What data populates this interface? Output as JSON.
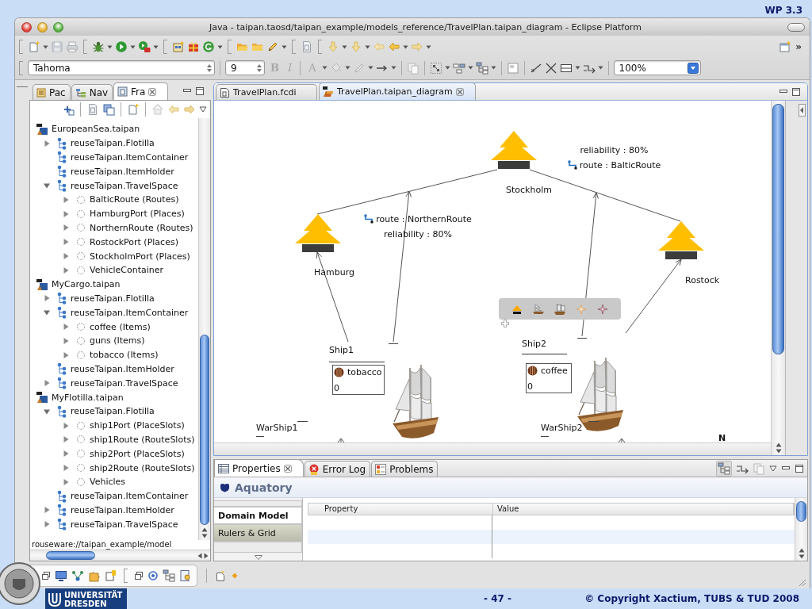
{
  "slide": {
    "section": "WP 3.3",
    "logo_text": [
      "UNIVERSITÄT",
      "DRESDEN"
    ],
    "page_number": "- 47 -",
    "copyright": "© Copyright Xactium, TUBS & TUD 2008"
  },
  "window": {
    "title": "Java - taipan.taosd/taipan_example/models_reference/TravelPlan.taipan_diagram - Eclipse Platform"
  },
  "main_toolbar": {
    "overflow": "»"
  },
  "format_toolbar": {
    "font": "Tahoma",
    "size": "9",
    "buttons": [
      {
        "label": "B",
        "kind": "bold",
        "disabled": true
      },
      {
        "label": "I",
        "kind": "italic",
        "disabled": true
      },
      {
        "label": "A",
        "kind": "font_color",
        "disabled": true
      }
    ],
    "zoom": "100%"
  },
  "navigator": {
    "tabs": [
      {
        "label": "Pac",
        "selected": false
      },
      {
        "label": "Nav",
        "selected": false
      },
      {
        "label": "Fra",
        "selected": true
      }
    ],
    "tree": [
      {
        "label": "EuropeanSea.taipan",
        "kind": "file",
        "children": [
          {
            "label": "reuseTaipan.Flotilla",
            "kind": "package",
            "expanded": false
          },
          {
            "label": "reuseTaipan.ItemContainer",
            "kind": "package"
          },
          {
            "label": "reuseTaipan.ItemHolder",
            "kind": "package"
          },
          {
            "label": "reuseTaipan.TravelSpace",
            "kind": "package",
            "expanded": true,
            "children": [
              {
                "label": "BalticRoute (Routes)",
                "kind": "element",
                "expanded": false
              },
              {
                "label": "HamburgPort (Places)",
                "kind": "element",
                "expanded": false
              },
              {
                "label": "NorthernRoute (Routes)",
                "kind": "element",
                "expanded": false
              },
              {
                "label": "RostockPort (Places)",
                "kind": "element",
                "expanded": false
              },
              {
                "label": "StockholmPort (Places)",
                "kind": "element",
                "expanded": false
              },
              {
                "label": "VehicleContainer",
                "kind": "element",
                "expanded": false
              }
            ]
          }
        ]
      },
      {
        "label": "MyCargo.taipan",
        "kind": "file",
        "children": [
          {
            "label": "reuseTaipan.Flotilla",
            "kind": "package",
            "expanded": false
          },
          {
            "label": "reuseTaipan.ItemContainer",
            "kind": "package",
            "expanded": true,
            "children": [
              {
                "label": "coffee (Items)",
                "kind": "element",
                "expanded": false
              },
              {
                "label": "guns (Items)",
                "kind": "element",
                "expanded": false
              },
              {
                "label": "tobacco (Items)",
                "kind": "element",
                "expanded": false
              }
            ]
          },
          {
            "label": "reuseTaipan.ItemHolder",
            "kind": "package"
          },
          {
            "label": "reuseTaipan.TravelSpace",
            "kind": "package",
            "expanded": false
          }
        ]
      },
      {
        "label": "MyFlotilla.taipan",
        "kind": "file",
        "children": [
          {
            "label": "reuseTaipan.Flotilla",
            "kind": "package",
            "expanded": true,
            "children": [
              {
                "label": "ship1Port (PlaceSlots)",
                "kind": "element",
                "expanded": false
              },
              {
                "label": "ship1Route (RouteSlots)",
                "kind": "element",
                "expanded": false
              },
              {
                "label": "ship2Port (PlaceSlots)",
                "kind": "element",
                "expanded": false
              },
              {
                "label": "ship2Route (RouteSlots)",
                "kind": "element",
                "expanded": false
              },
              {
                "label": "Vehicles",
                "kind": "element",
                "expanded": false
              }
            ]
          },
          {
            "label": "reuseTaipan.ItemContainer",
            "kind": "package"
          },
          {
            "label": "reuseTaipan.ItemHolder",
            "kind": "package",
            "expanded": false
          },
          {
            "label": "reuseTaipan.TravelSpace",
            "kind": "package",
            "expanded": false
          }
        ]
      }
    ],
    "location": "rouseware://taipan_example/model"
  },
  "editor": {
    "tabs": [
      {
        "label": "TravelPlan.fcdi",
        "selected": false
      },
      {
        "label": "TravelPlan.taipan_diagram",
        "selected": true
      }
    ],
    "diagram": {
      "places": [
        {
          "name": "Stockholm"
        },
        {
          "name": "Hamburg"
        },
        {
          "name": "Rostock"
        }
      ],
      "route_labels": [
        {
          "lines": [
            {
              "kind": "attribute",
              "text": "reliability : 80%"
            },
            {
              "kind": "route",
              "text": "route : BalticRoute"
            }
          ]
        },
        {
          "lines": [
            {
              "kind": "route",
              "text": "route : NorthernRoute"
            },
            {
              "kind": "attribute",
              "text": "reliability : 80%"
            }
          ]
        }
      ],
      "ships": [
        {
          "name": "Ship1",
          "cargo": {
            "item": "tobacco",
            "amount": "0"
          }
        },
        {
          "name": "Ship2",
          "cargo": {
            "item": "coffee",
            "amount": "0"
          }
        }
      ],
      "warships": [
        {
          "name": "WarShip1"
        },
        {
          "name": "WarShip2"
        }
      ],
      "compass": "N"
    }
  },
  "properties": {
    "tabs": [
      {
        "label": "Properties",
        "selected": true
      },
      {
        "label": "Error Log",
        "selected": false
      },
      {
        "label": "Problems",
        "selected": false
      }
    ],
    "title": "Aquatory",
    "sections": [
      {
        "label": "Domain Model",
        "selected": true
      },
      {
        "label": "Rulers & Grid",
        "selected": false
      }
    ],
    "columns": [
      "Property",
      "Value"
    ]
  }
}
